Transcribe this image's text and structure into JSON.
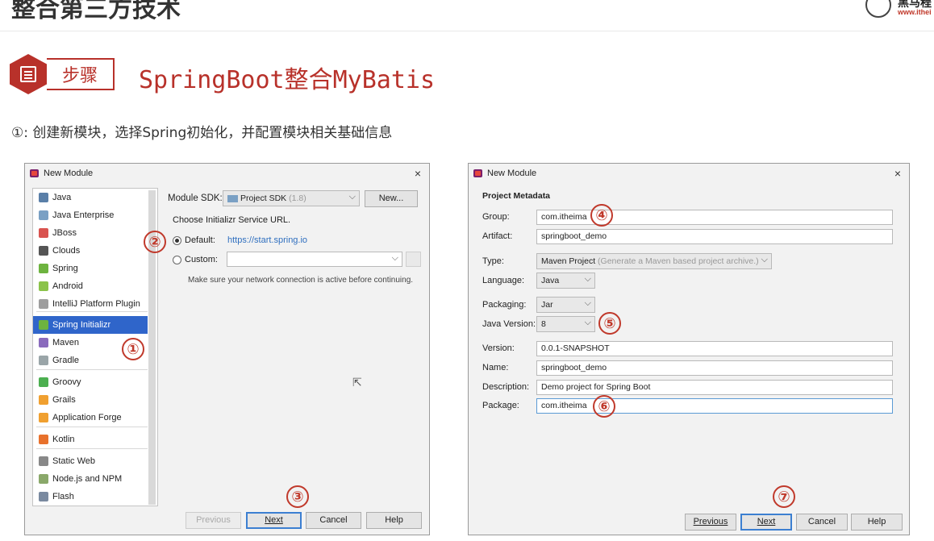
{
  "slide": {
    "title": "整合第三方技术",
    "logo_text": "黑马程",
    "logo_url": "www.ithei",
    "step_label": "步骤",
    "step_heading": "SpringBoot整合MyBatis",
    "instruction": "①: 创建新模块，选择Spring初始化，并配置模块相关基础信息"
  },
  "dialog1": {
    "title": "New Module",
    "close": "×",
    "module_types": [
      {
        "label": "Java",
        "icon": "java-icon",
        "color": "#5a7fa8"
      },
      {
        "label": "Java Enterprise",
        "icon": "java-enterprise-icon",
        "color": "#7aa0c4"
      },
      {
        "label": "JBoss",
        "icon": "jboss-icon",
        "color": "#d9534f"
      },
      {
        "label": "Clouds",
        "icon": "clouds-icon",
        "color": "#555555"
      },
      {
        "label": "Spring",
        "icon": "spring-icon",
        "color": "#6db33f"
      },
      {
        "label": "Android",
        "icon": "android-icon",
        "color": "#8bc34a"
      },
      {
        "label": "IntelliJ Platform Plugin",
        "icon": "plugin-icon",
        "color": "#9e9e9e"
      },
      {
        "label": "Spring Initializr",
        "icon": "spring-initializr-icon",
        "color": "#6db33f",
        "selected": true
      },
      {
        "label": "Maven",
        "icon": "maven-icon",
        "color": "#8a6bbd"
      },
      {
        "label": "Gradle",
        "icon": "gradle-icon",
        "color": "#9aa5a8"
      },
      {
        "label": "Groovy",
        "icon": "groovy-icon",
        "color": "#4caf50"
      },
      {
        "label": "Grails",
        "icon": "grails-icon",
        "color": "#f0a030"
      },
      {
        "label": "Application Forge",
        "icon": "application-forge-icon",
        "color": "#f0a030"
      },
      {
        "label": "Kotlin",
        "icon": "kotlin-icon",
        "color": "#e8712c"
      },
      {
        "label": "Static Web",
        "icon": "static-web-icon",
        "color": "#888888"
      },
      {
        "label": "Node.js and NPM",
        "icon": "nodejs-icon",
        "color": "#8aa86a"
      },
      {
        "label": "Flash",
        "icon": "flash-icon",
        "color": "#7a8aa0"
      }
    ],
    "sdk_label": "Module SDK:",
    "sdk_value": "Project SDK",
    "sdk_version": "(1.8)",
    "new_button": "New...",
    "initializr_heading": "Choose Initializr Service URL.",
    "default_label": "Default:",
    "default_url": "https://start.spring.io",
    "custom_label": "Custom:",
    "network_hint": "Make sure your network connection is active before continuing.",
    "buttons": {
      "previous": "Previous",
      "next": "Next",
      "cancel": "Cancel",
      "help": "Help"
    },
    "markers": {
      "one": "①",
      "two": "②",
      "three": "③"
    }
  },
  "dialog2": {
    "title": "New Module",
    "close": "×",
    "section_title": "Project Metadata",
    "fields": {
      "group": {
        "label": "Group:",
        "value": "com.itheima"
      },
      "artifact": {
        "label": "Artifact:",
        "value": "springboot_demo"
      },
      "type": {
        "label": "Type:",
        "value": "Maven Project",
        "hint": "(Generate a Maven based project archive.)"
      },
      "language": {
        "label": "Language:",
        "value": "Java"
      },
      "packaging": {
        "label": "Packaging:",
        "value": "Jar"
      },
      "java_version": {
        "label": "Java Version:",
        "value": "8"
      },
      "version": {
        "label": "Version:",
        "value": "0.0.1-SNAPSHOT"
      },
      "name": {
        "label": "Name:",
        "value": "springboot_demo"
      },
      "description": {
        "label": "Description:",
        "value": "Demo project for Spring Boot"
      },
      "package": {
        "label": "Package:",
        "value": "com.itheima"
      }
    },
    "buttons": {
      "previous": "Previous",
      "next": "Next",
      "cancel": "Cancel",
      "help": "Help"
    },
    "markers": {
      "four": "④",
      "five": "⑤",
      "six": "⑥",
      "seven": "⑦"
    }
  }
}
